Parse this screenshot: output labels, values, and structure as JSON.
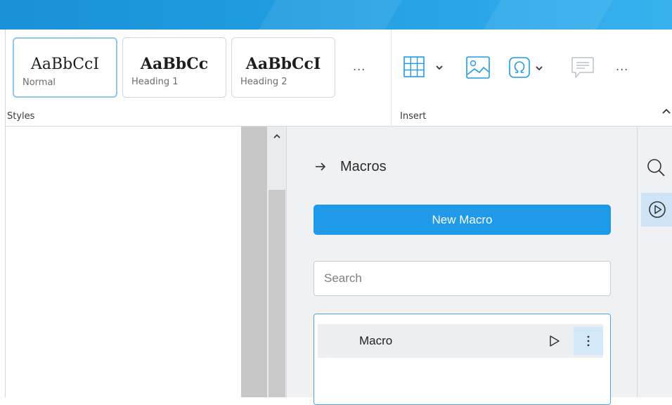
{
  "ribbon": {
    "styles": {
      "group_label": "Styles",
      "cards": [
        {
          "sample": "AaBbCcI",
          "caption": "Normal"
        },
        {
          "sample": "AaBbCc",
          "caption": "Heading 1"
        },
        {
          "sample": "AaBbCcI",
          "caption": "Heading 2"
        }
      ],
      "more": "..."
    },
    "insert": {
      "group_label": "Insert",
      "more": "...",
      "tools": [
        "table-icon",
        "image-icon",
        "special-character-icon",
        "comment-icon"
      ]
    }
  },
  "macros_panel": {
    "title": "Macros",
    "new_macro_label": "New Macro",
    "search_placeholder": "Search",
    "items": [
      {
        "name": "Macro"
      }
    ]
  },
  "sidebar": {
    "tools": [
      "search-icon",
      "macros-icon"
    ]
  },
  "colors": {
    "accent": "#1f9ae8",
    "titlebar": "#1f9be0",
    "panel_bg": "#f0f1f3",
    "selected_bg": "#cfe4f6"
  }
}
